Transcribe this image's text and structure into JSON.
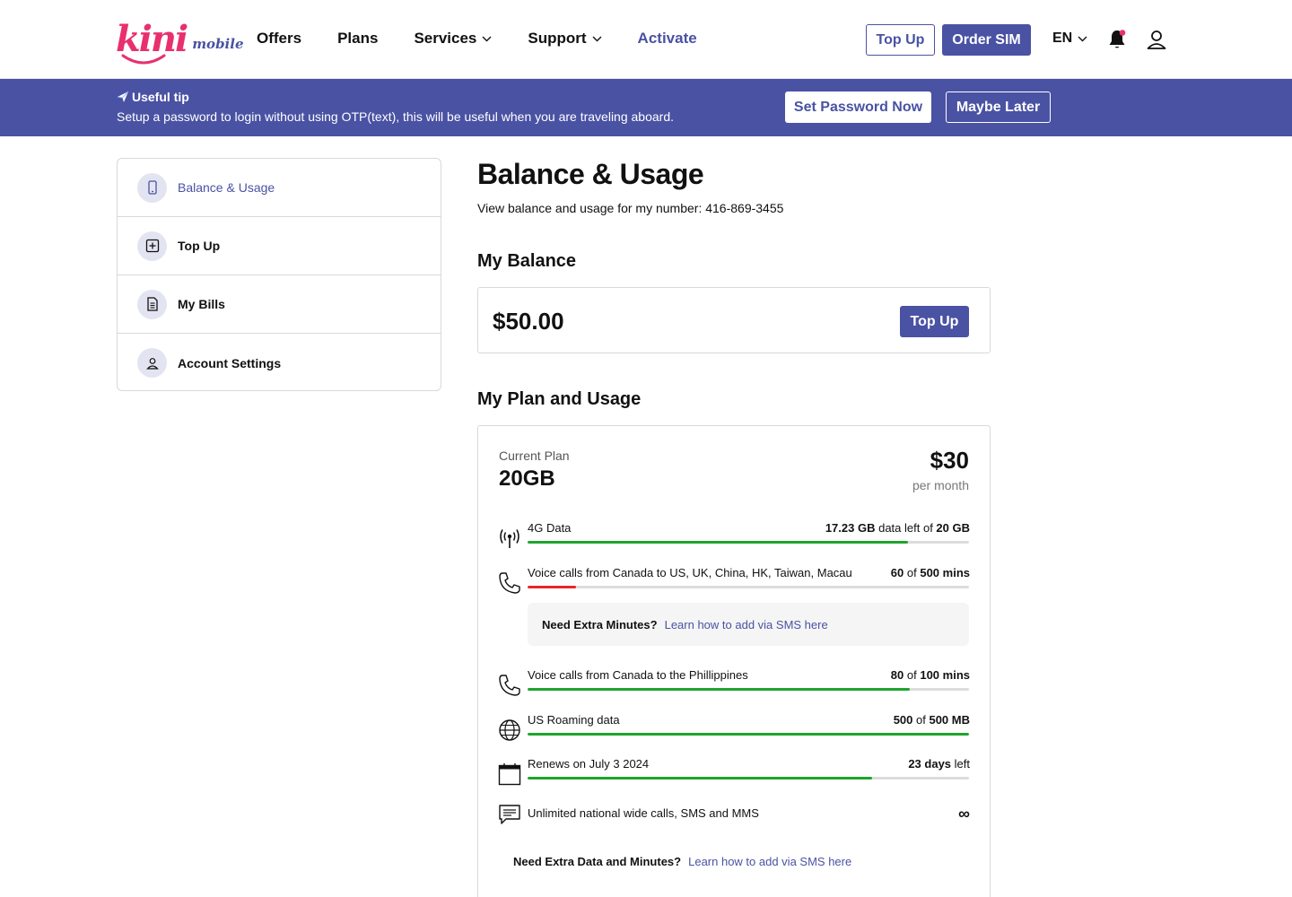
{
  "header": {
    "logo_main": "kini",
    "logo_sub": "mobile",
    "nav": [
      {
        "label": "Offers",
        "dropdown": false,
        "accent": false
      },
      {
        "label": "Plans",
        "dropdown": false,
        "accent": false
      },
      {
        "label": "Services",
        "dropdown": true,
        "accent": false
      },
      {
        "label": "Support",
        "dropdown": true,
        "accent": false
      },
      {
        "label": "Activate",
        "dropdown": false,
        "accent": true
      }
    ],
    "top_up_label": "Top Up",
    "order_sim_label": "Order SIM",
    "language": "EN",
    "icons": [
      "bell-icon",
      "user-icon"
    ]
  },
  "tip": {
    "title": "Useful tip",
    "text": "Setup a password to login without using OTP(text), this will be useful when you are traveling aboard.",
    "primary_label": "Set Password Now",
    "secondary_label": "Maybe Later"
  },
  "sidebar": {
    "items": [
      {
        "label": "Balance & Usage",
        "icon": "phone-icon",
        "active": true
      },
      {
        "label": "Top Up",
        "icon": "plus-square-icon",
        "active": false
      },
      {
        "label": "My Bills",
        "icon": "bill-icon",
        "active": false
      },
      {
        "label": "Account Settings",
        "icon": "person-icon",
        "active": false
      }
    ]
  },
  "main": {
    "title": "Balance & Usage",
    "subtitle": "View balance and usage for my number: 416-869-3455",
    "balance_heading": "My Balance",
    "balance_amount": "$50.00",
    "balance_button": "Top Up",
    "plan_heading": "My Plan and Usage",
    "plan": {
      "label": "Current Plan",
      "name": "20GB",
      "price": "$30",
      "period": "per month"
    },
    "usage": [
      {
        "icon": "signal-icon",
        "label": "4G Data",
        "value_a": "17.23 GB",
        "mid": " data left of ",
        "value_b": "20 GB",
        "tail": "",
        "fraction": 0.8615,
        "color": "#1fa42d"
      },
      {
        "icon": "phone-call-icon",
        "label": "Voice calls from Canada to US, UK, China, HK, Taiwan, Macau",
        "value_a": "60",
        "mid": " of ",
        "value_b": "500 mins",
        "tail": "",
        "fraction": 0.11,
        "color": "#e8262b"
      },
      {
        "icon": "phone-call-icon",
        "label": "Voice calls from Canada to the Phillippines",
        "value_a": "80",
        "mid": " of ",
        "value_b": "100 mins",
        "tail": "",
        "fraction": 0.865,
        "color": "#1fa42d"
      },
      {
        "icon": "globe-icon",
        "label": "US Roaming data",
        "value_a": "500",
        "mid": " of ",
        "value_b": "500 MB",
        "tail": "",
        "fraction": 1.0,
        "color": "#1fa42d"
      },
      {
        "icon": "calendar-icon",
        "label": "Renews on July 3 2024",
        "value_a": "23 days",
        "mid": "",
        "value_b": "",
        "tail": " left",
        "fraction": 0.78,
        "color": "#1fa42d"
      }
    ],
    "extra_minutes": {
      "question": "Need Extra Minutes?",
      "link": "Learn how to add via SMS here"
    },
    "unlimited": {
      "label": "Unlimited national wide calls, SMS and MMS",
      "value": "∞"
    },
    "extra_data": {
      "question": "Need Extra Data and  Minutes?",
      "link": "Learn how to add via SMS here"
    }
  }
}
